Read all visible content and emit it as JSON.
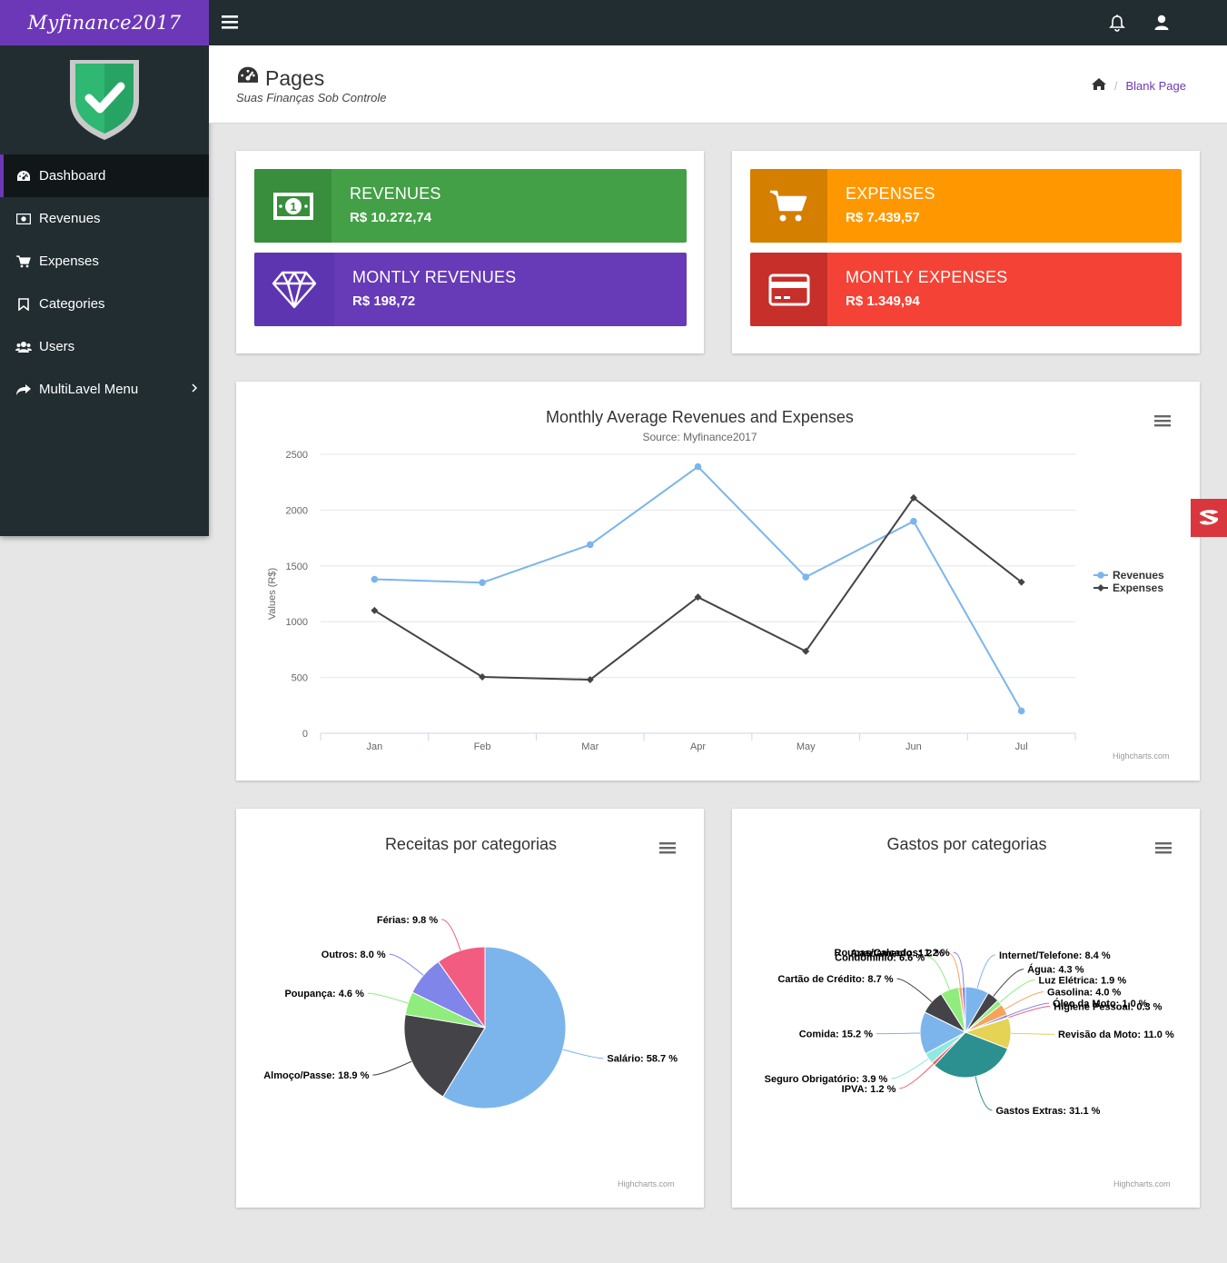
{
  "brand": "Myfinance2017",
  "sidebar": {
    "items": [
      {
        "label": "Dashboard",
        "icon": "dashboard-icon"
      },
      {
        "label": "Revenues",
        "icon": "money-icon"
      },
      {
        "label": "Expenses",
        "icon": "cart-icon"
      },
      {
        "label": "Categories",
        "icon": "bookmark-icon"
      },
      {
        "label": "Users",
        "icon": "users-icon"
      },
      {
        "label": "MultiLavel Menu",
        "icon": "share-icon"
      }
    ]
  },
  "header": {
    "title": "Pages",
    "subtitle": "Suas Finanças Sob Controle",
    "breadcrumb": "Blank Page"
  },
  "tiles": {
    "revenues": {
      "label": "REVENUES",
      "value": "R$ 10.272,74",
      "color": "#43a047"
    },
    "expenses": {
      "label": "EXPENSES",
      "value": "R$ 7.439,57",
      "color": "#ff9800"
    },
    "monthly_revenues": {
      "label": "MONTLY REVENUES",
      "value": "R$ 198,72",
      "color": "#673ab7"
    },
    "monthly_expenses": {
      "label": "MONTLY EXPENSES",
      "value": "R$ 1.349,94",
      "color": "#f44336"
    }
  },
  "credits": "Highcharts.com",
  "chart_data": [
    {
      "type": "line",
      "title": "Monthly Average Revenues and Expenses",
      "subtitle": "Source: Myfinance2017",
      "ylabel": "Values (R$)",
      "xlabel": "",
      "categories": [
        "Jan",
        "Feb",
        "Mar",
        "Apr",
        "May",
        "Jun",
        "Jul"
      ],
      "ylim": [
        0,
        2500
      ],
      "yticks": [
        0,
        500,
        1000,
        1500,
        2000,
        2500
      ],
      "grid": true,
      "legend": "right",
      "series": [
        {
          "name": "Revenues",
          "color": "#7cb5ec",
          "values": [
            1380,
            1350,
            1690,
            2390,
            1400,
            1900,
            200
          ]
        },
        {
          "name": "Expenses",
          "color": "#434348",
          "values": [
            1100,
            505,
            480,
            1220,
            735,
            2110,
            1355
          ]
        }
      ]
    },
    {
      "type": "pie",
      "title": "Receitas por categorias",
      "slices": [
        {
          "label": "Salário",
          "value": 58.7,
          "color": "#7cb5ec"
        },
        {
          "label": "Almoço/Passe",
          "value": 18.9,
          "color": "#434348"
        },
        {
          "label": "Poupança",
          "value": 4.6,
          "color": "#90ed7d"
        },
        {
          "label": "Outros",
          "value": 8.0,
          "color": "#8085e9"
        },
        {
          "label": "Férias",
          "value": 9.8,
          "color": "#f15c80"
        }
      ]
    },
    {
      "type": "pie",
      "title": "Gastos por categorias",
      "slices": [
        {
          "label": "Internet/Telefone",
          "value": 8.4,
          "color": "#7cb5ec"
        },
        {
          "label": "Água",
          "value": 4.3,
          "color": "#434348"
        },
        {
          "label": "Luz Elétrica",
          "value": 1.9,
          "color": "#90ed7d"
        },
        {
          "label": "Gasolina",
          "value": 4.0,
          "color": "#f7a35c"
        },
        {
          "label": "Óleo da Moto",
          "value": 1.0,
          "color": "#8085e9"
        },
        {
          "label": "Higiene Pessoal",
          "value": 0.3,
          "color": "#f15c80"
        },
        {
          "label": "Revisão da Moto",
          "value": 11.0,
          "color": "#e4d354"
        },
        {
          "label": "Gastos Extras",
          "value": 31.1,
          "color": "#2b908f"
        },
        {
          "label": "IPVA",
          "value": 1.2,
          "color": "#f45b5b"
        },
        {
          "label": "Seguro Obrigatório",
          "value": 3.9,
          "color": "#91e8e1"
        },
        {
          "label": "Comida",
          "value": 15.2,
          "color": "#7cb5ec"
        },
        {
          "label": "Cartão de Crédito",
          "value": 8.7,
          "color": "#434348"
        },
        {
          "label": "Condomínio",
          "value": 6.6,
          "color": "#90ed7d"
        },
        {
          "label": "Apartamento",
          "value": 1.2,
          "color": "#f7a35c"
        },
        {
          "label": "Roupas/Calçados",
          "value": 1.2,
          "color": "#8085e9"
        }
      ]
    }
  ]
}
